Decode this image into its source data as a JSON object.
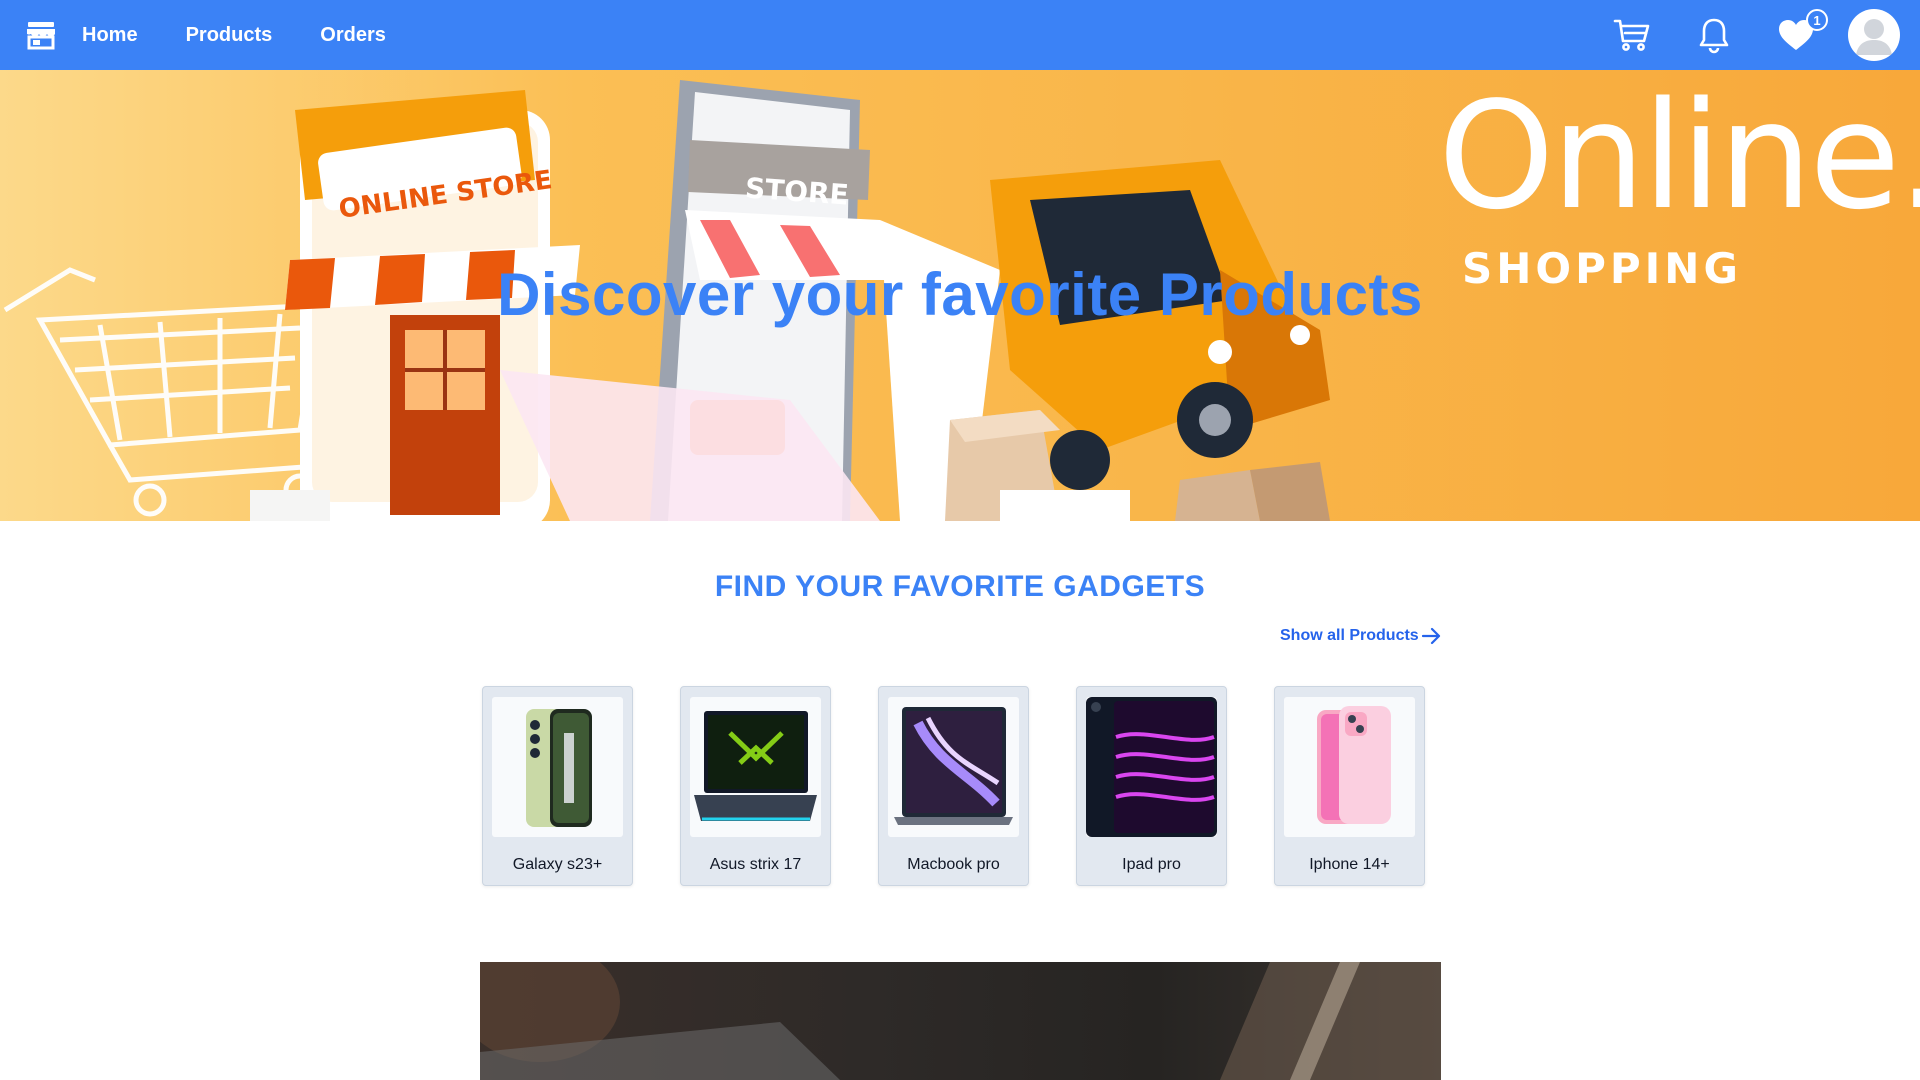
{
  "nav": {
    "links": [
      "Home",
      "Products",
      "Orders"
    ],
    "wishlist_badge": "1"
  },
  "hero": {
    "title": "Discover your favorite Products",
    "brand_line1": "Online.",
    "brand_line2": "SHOPPING",
    "sign_store": "ONLINE STORE",
    "sign_phone": "STORE"
  },
  "section": {
    "title": "FIND YOUR FAVORITE GADGETS",
    "show_all": "Show all Products"
  },
  "products": [
    {
      "name": "Galaxy s23+",
      "icon": "phone-image"
    },
    {
      "name": "Asus strix 17",
      "icon": "laptop-image"
    },
    {
      "name": "Macbook pro",
      "icon": "laptop-image"
    },
    {
      "name": "Ipad pro",
      "icon": "tablet-image"
    },
    {
      "name": "Iphone 14+",
      "icon": "phone-image"
    }
  ],
  "colors": {
    "primary": "#3b82f6",
    "hero_orange": "#f9b64a"
  }
}
